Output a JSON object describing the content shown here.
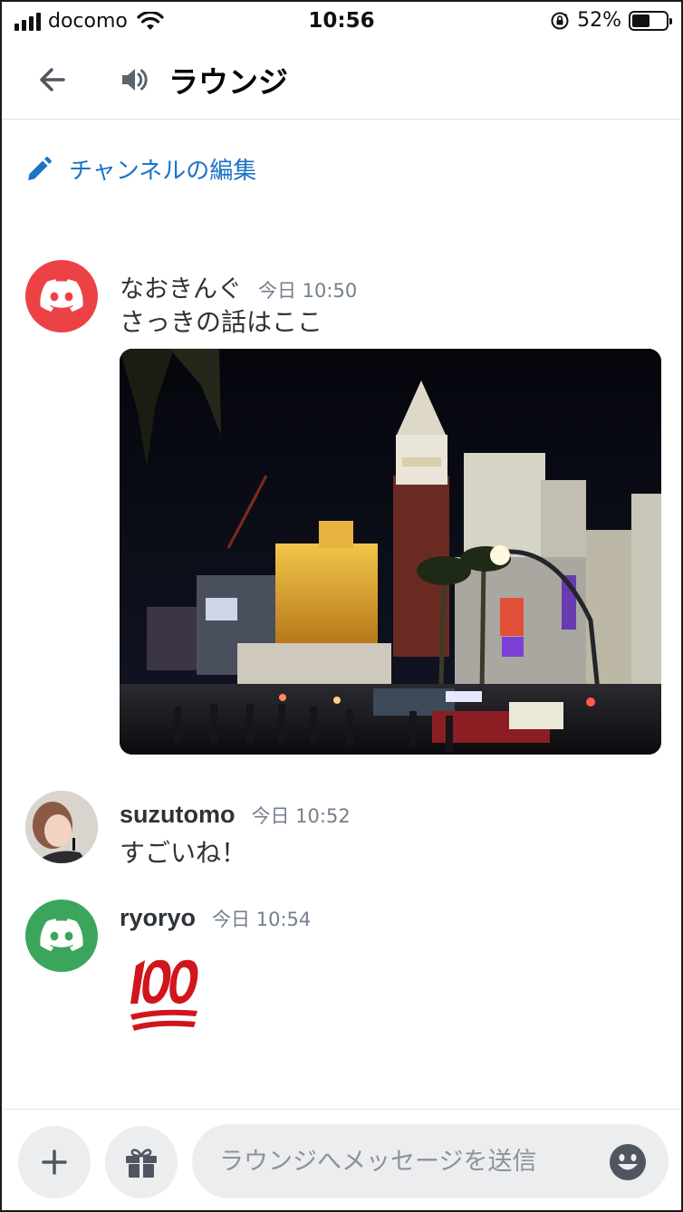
{
  "status_bar": {
    "carrier": "docomo",
    "time": "10:56",
    "battery_percent": "52%",
    "battery_level": 0.52
  },
  "header": {
    "channel_name": "ラウンジ",
    "back_icon": "arrow-left-icon",
    "channel_icon": "speaker-icon"
  },
  "edit_channel": {
    "label": "チャンネルの編集",
    "icon": "pencil-icon",
    "color": "#1a73c9"
  },
  "messages": [
    {
      "author": "なおきんぐ",
      "timestamp": "今日 10:50",
      "text": "さっきの話はここ",
      "avatar": "discord-logo-red",
      "attachment": "night-city-photo"
    },
    {
      "author": "suzutomo",
      "timestamp": "今日 10:52",
      "text": "すごいね！",
      "avatar": "user-photo"
    },
    {
      "author": "ryoryo",
      "timestamp": "今日 10:54",
      "text": "",
      "emoji": "hundred-points-emoji",
      "avatar": "discord-logo-green"
    }
  ],
  "composer": {
    "placeholder": "ラウンジへメッセージを送信",
    "add_icon": "plus-icon",
    "gift_icon": "gift-icon",
    "emoji_icon": "smiley-icon"
  },
  "colors": {
    "discord_red": "#ed4245",
    "discord_green": "#3ba55c",
    "link_blue": "#1a73c9",
    "input_bg": "#ebedef"
  }
}
